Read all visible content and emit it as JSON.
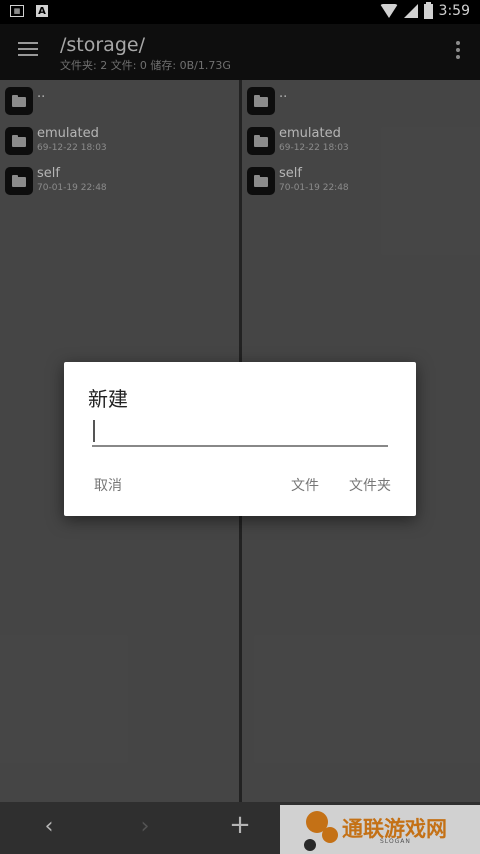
{
  "status_bar": {
    "time": "3:59",
    "left_icons": [
      "sim-icon",
      "a-icon"
    ],
    "right_icons": [
      "wifi-icon",
      "signal-icon",
      "battery-icon"
    ]
  },
  "app_bar": {
    "title": "/storage/",
    "subtitle": "文件夹: 2  文件: 0  储存: 0B/1.73G"
  },
  "left_pane": {
    "items": [
      {
        "name": "..",
        "date": ""
      },
      {
        "name": "emulated",
        "date": "69-12-22 18:03"
      },
      {
        "name": "self",
        "date": "70-01-19 22:48"
      }
    ]
  },
  "right_pane": {
    "items": [
      {
        "name": "..",
        "date": ""
      },
      {
        "name": "emulated",
        "date": "69-12-22 18:03"
      },
      {
        "name": "self",
        "date": "70-01-19 22:48"
      }
    ]
  },
  "bottom_bar": {
    "back": "‹",
    "forward": "›",
    "add": "+"
  },
  "dialog": {
    "title": "新建",
    "input_value": "",
    "cancel_label": "取消",
    "file_label": "文件",
    "folder_label": "文件夹"
  },
  "watermark": {
    "text": "通联游戏网",
    "slogan": "SLOGAN",
    "accent": "#f08a1c"
  }
}
